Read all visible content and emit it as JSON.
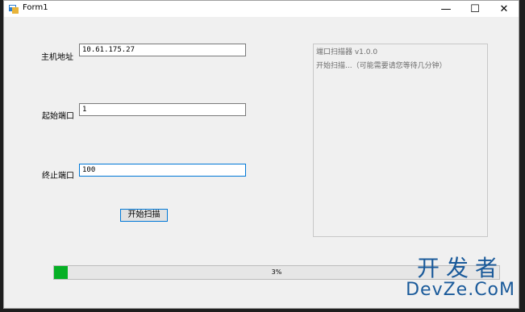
{
  "window": {
    "title": "Form1",
    "minimize_glyph": "—",
    "maximize_glyph": "☐",
    "close_glyph": "✕"
  },
  "form": {
    "host_label": "主机地址",
    "host_value": "10.61.175.27",
    "start_port_label": "起始端口",
    "start_port_value": "1",
    "end_port_label": "终止端口",
    "end_port_value": "100",
    "scan_button": "开始扫描"
  },
  "log": {
    "lines": [
      "端口扫描器 v1.0.0",
      "开始扫描...（可能需要请您等待几分钟）"
    ]
  },
  "progress": {
    "value": 0.03,
    "label": "3%",
    "color": "#06b025"
  },
  "watermark": {
    "top": "开发者",
    "bottom": "DevZe.CoM"
  }
}
